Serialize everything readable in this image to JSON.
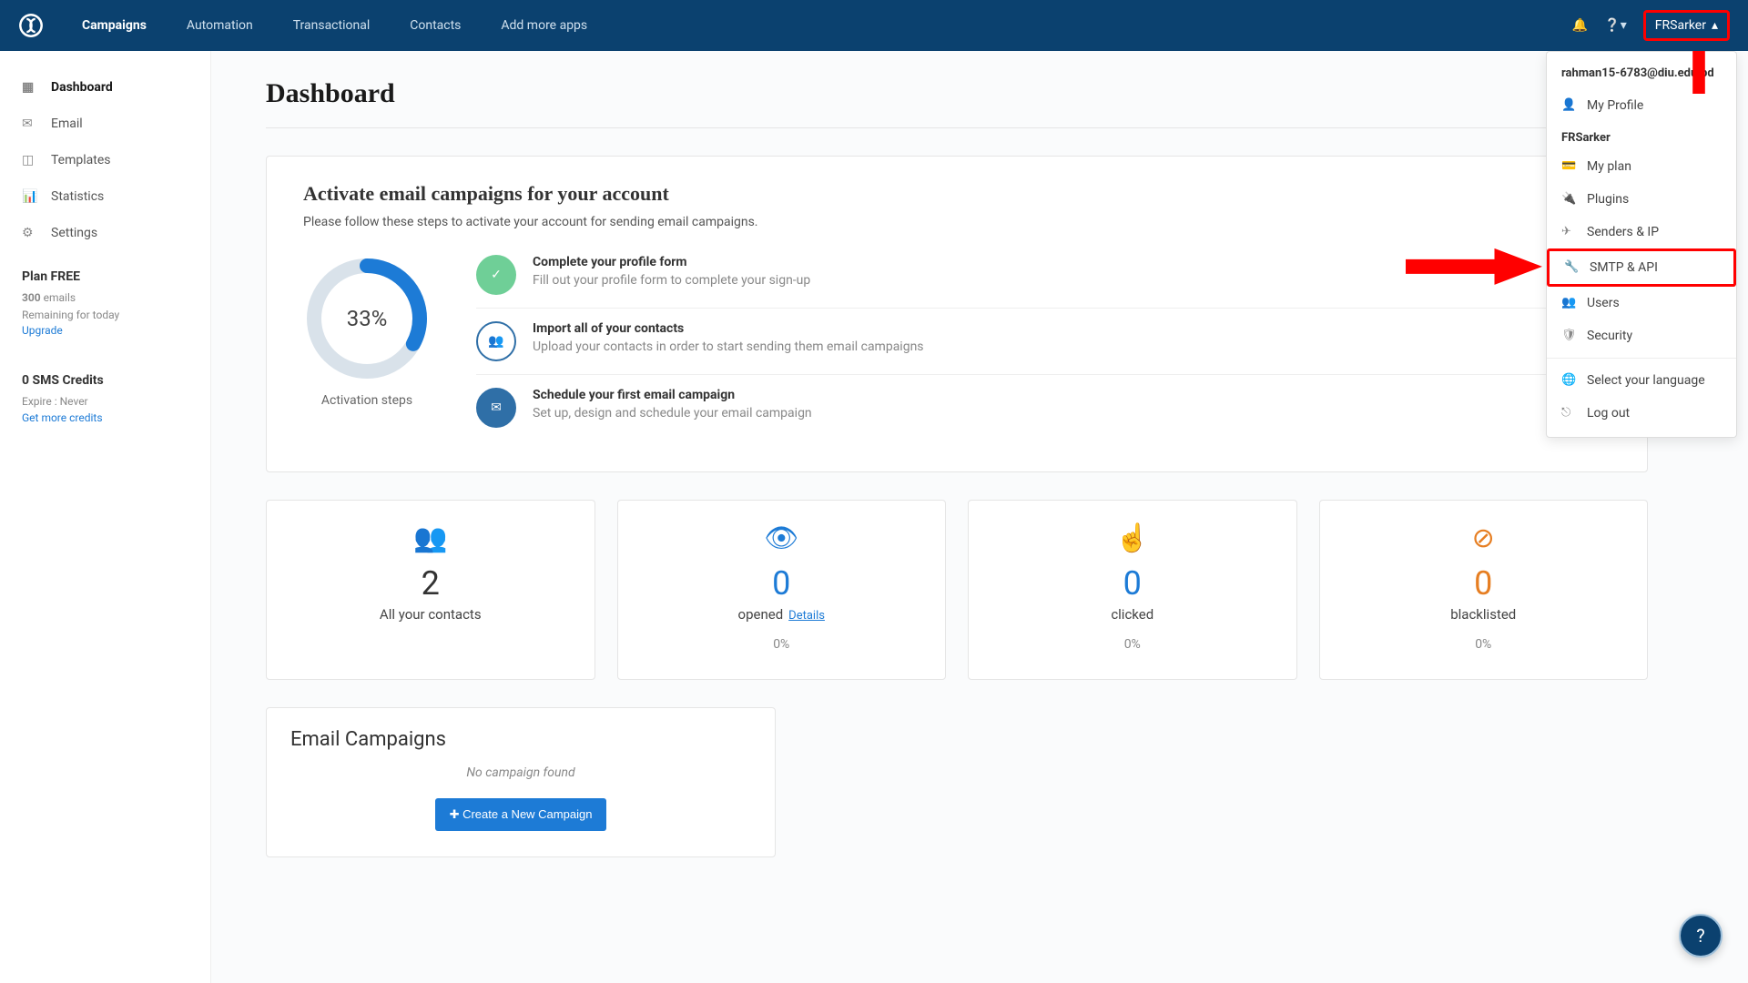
{
  "nav": {
    "items": [
      "Campaigns",
      "Automation",
      "Transactional",
      "Contacts",
      "Add more apps"
    ],
    "user": "FRSarker"
  },
  "sidebar": {
    "items": [
      {
        "label": "Dashboard"
      },
      {
        "label": "Email"
      },
      {
        "label": "Templates"
      },
      {
        "label": "Statistics"
      },
      {
        "label": "Settings"
      }
    ],
    "plan": {
      "title": "Plan FREE",
      "emails_count": "300",
      "emails_label": "emails",
      "remaining": "Remaining for today",
      "upgrade": "Upgrade"
    },
    "sms": {
      "title": "0 SMS Credits",
      "expire": "Expire : Never",
      "link": "Get more credits"
    }
  },
  "page_title": "Dashboard",
  "activation": {
    "title": "Activate email campaigns for your account",
    "subtitle": "Please follow these steps to activate your account for sending email campaigns.",
    "percent": "33%",
    "percent_label": "Activation steps",
    "steps": [
      {
        "title": "Complete your profile form",
        "desc": "Fill out your profile form to complete your sign-up"
      },
      {
        "title": "Import all of your contacts",
        "desc": "Upload your contacts in order to start sending them email campaigns"
      },
      {
        "title": "Schedule your first email campaign",
        "desc": "Set up, design and schedule your email campaign"
      }
    ]
  },
  "stats": [
    {
      "value": "2",
      "label": "All your contacts"
    },
    {
      "value": "0",
      "label": "opened",
      "details": "Details",
      "pct": "0%"
    },
    {
      "value": "0",
      "label": "clicked",
      "pct": "0%"
    },
    {
      "value": "0",
      "label": "blacklisted",
      "pct": "0%"
    }
  ],
  "campaigns": {
    "title": "Email Campaigns",
    "empty": "No campaign found",
    "button": "Create a New Campaign"
  },
  "dropdown": {
    "email": "rahman15-6783@diu.edu.bd",
    "profile": "My Profile",
    "section": "FRSarker",
    "items": [
      "My plan",
      "Plugins",
      "Senders & IP",
      "SMTP & API",
      "Users",
      "Security"
    ],
    "lang": "Select your language",
    "logout": "Log out"
  }
}
